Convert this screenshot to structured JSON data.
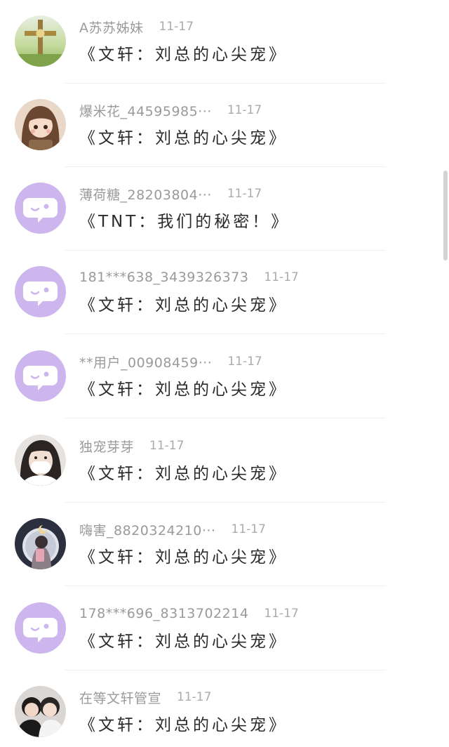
{
  "comments": [
    {
      "username": "A苏苏姊妹",
      "date": "11-17",
      "message": "《文轩：刘总的心尖宠》",
      "avatar": "cross-photo"
    },
    {
      "username": "爆米花_44595985···",
      "date": "11-17",
      "message": "《文轩：刘总的心尖宠》",
      "avatar": "cartoon-girl"
    },
    {
      "username": "薄荷糖_28203804···",
      "date": "11-17",
      "message": "《TNT：我们的秘密！》",
      "avatar": "default-chat"
    },
    {
      "username": "181***638_3439326373",
      "date": "11-17",
      "message": "《文轩：刘总的心尖宠》",
      "avatar": "default-chat"
    },
    {
      "username": "**用户_00908459···",
      "date": "11-17",
      "message": "《文轩：刘总的心尖宠》",
      "avatar": "default-chat"
    },
    {
      "username": "独宠芽芽",
      "date": "11-17",
      "message": "《文轩：刘总的心尖宠》",
      "avatar": "masked-girl"
    },
    {
      "username": "嗨害_8820324210···",
      "date": "11-17",
      "message": "《文轩：刘总的心尖宠》",
      "avatar": "mirror-selfie"
    },
    {
      "username": "178***696_8313702214",
      "date": "11-17",
      "message": "《文轩：刘总的心尖宠》",
      "avatar": "default-chat"
    },
    {
      "username": "在等文轩管宣",
      "date": "11-17",
      "message": "《文轩：刘总的心尖宠》",
      "avatar": "two-boys"
    }
  ],
  "colors": {
    "default_avatar_bg": "#cdb6ee",
    "username": "#9a9a9a",
    "message": "#2b2b2b"
  }
}
